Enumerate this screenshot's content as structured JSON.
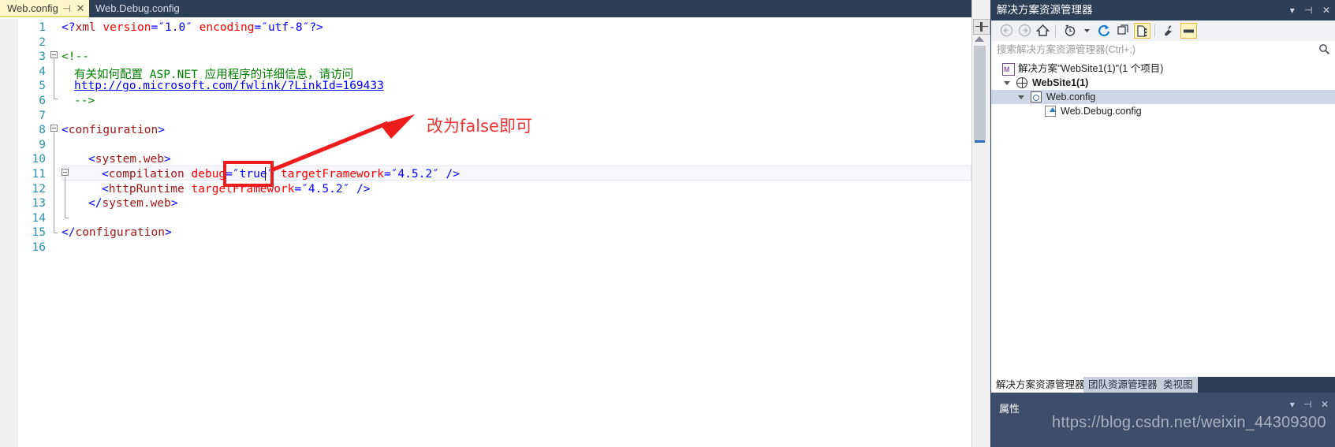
{
  "editor": {
    "tabs": [
      {
        "label": "Web.config",
        "active": true,
        "pin_icon": "pin-icon",
        "close_icon": "close-icon"
      },
      {
        "label": "Web.Debug.config",
        "active": false
      }
    ],
    "lines": [
      {
        "num": "1",
        "text": "<?xml version=\"1.0\" encoding=\"utf-8\"?>"
      },
      {
        "num": "2",
        "text": ""
      },
      {
        "num": "3",
        "text": "<!--"
      },
      {
        "num": "4",
        "text": "    有关如何配置 ASP.NET 应用程序的详细信息，请访问"
      },
      {
        "num": "5",
        "text": "    http://go.microsoft.com/fwlink/?LinkId=169433"
      },
      {
        "num": "6",
        "text": "    -->"
      },
      {
        "num": "7",
        "text": ""
      },
      {
        "num": "8",
        "text": "<configuration>"
      },
      {
        "num": "9",
        "text": ""
      },
      {
        "num": "10",
        "text": "    <system.web>"
      },
      {
        "num": "11",
        "text": "      <compilation debug=\"true\" targetFramework=\"4.5.2\" />"
      },
      {
        "num": "12",
        "text": "      <httpRuntime targetFramework=\"4.5.2\" />"
      },
      {
        "num": "13",
        "text": "    </system.web>"
      },
      {
        "num": "14",
        "text": ""
      },
      {
        "num": "15",
        "text": "</configuration>"
      },
      {
        "num": "16",
        "text": ""
      }
    ],
    "comment_text": "有关如何配置 ASP.NET 应用程序的详细信息，请访问",
    "link_text": "http://go.microsoft.com/fwlink/?LinkId=169433",
    "annotation": {
      "text": "改为false即可",
      "color": "#ef3434",
      "highlight_value": "true"
    }
  },
  "explorer": {
    "title": "解决方案资源管理器",
    "title_controls": [
      "chevron-down-icon",
      "pin-icon",
      "close-icon"
    ],
    "toolbar": [
      {
        "name": "back-icon",
        "selected": false
      },
      {
        "name": "forward-icon",
        "selected": false
      },
      {
        "name": "home-icon",
        "selected": false
      },
      {
        "name": "pending-changes-icon",
        "selected": false
      },
      {
        "name": "dropdown-arrow-icon",
        "selected": false
      },
      {
        "name": "refresh-icon",
        "selected": false
      },
      {
        "name": "collapse-all-icon",
        "selected": false
      },
      {
        "name": "show-all-files-icon",
        "selected": true
      },
      {
        "name": "properties-wrench-icon",
        "selected": false
      },
      {
        "name": "preview-selected-items-icon",
        "selected": true
      }
    ],
    "search": {
      "placeholder": "搜索解决方案资源管理器(Ctrl+;)",
      "icon": "search-icon"
    },
    "tree": [
      {
        "label": "解决方案\"WebSite1(1)\"(1 个项目)",
        "indent": 0,
        "icon": "solution-icon",
        "twisty": "none",
        "bold": false,
        "selected": false
      },
      {
        "label": "WebSite1(1)",
        "indent": 1,
        "icon": "website-globe-icon",
        "twisty": "open",
        "bold": true,
        "selected": false
      },
      {
        "label": "Web.config",
        "indent": 2,
        "icon": "config-file-icon",
        "twisty": "open",
        "bold": false,
        "selected": true
      },
      {
        "label": "Web.Debug.config",
        "indent": 3,
        "icon": "xml-file-icon",
        "twisty": "none",
        "bold": false,
        "selected": false
      }
    ],
    "bottom_tabs": [
      {
        "label": "解决方案资源管理器",
        "active": true
      },
      {
        "label": "团队资源管理器",
        "active": false
      },
      {
        "label": "类视图",
        "active": false
      }
    ],
    "properties": {
      "label": "属性",
      "controls": [
        "chevron-down-icon",
        "pin-icon",
        "close-icon"
      ]
    }
  },
  "watermark": "https://blog.csdn.net/weixin_44309300"
}
